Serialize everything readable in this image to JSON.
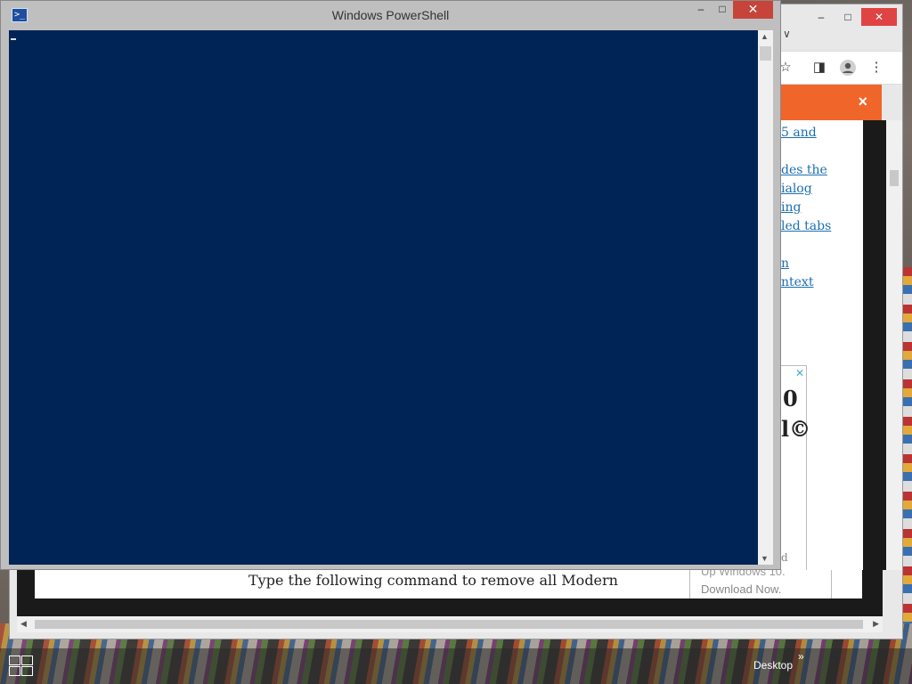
{
  "powershell": {
    "title": "Windows PowerShell",
    "icon": "powershell-icon",
    "minimize": "–",
    "maximize": "□",
    "close": "✕"
  },
  "browser": {
    "minimize": "–",
    "maximize": "□",
    "close": "✕",
    "tab_arrow": "∨",
    "toolbar_icons": [
      "star-icon",
      "sidebar-icon",
      "profile-icon",
      "more-icon"
    ],
    "star": "☆",
    "sidebar": "◨",
    "more": "⋮",
    "banner_close": "×",
    "banner_color": "#f0652a",
    "links": [
      "5 and",
      "des the",
      "ialog",
      "ing",
      "led tabs",
      "n",
      "ntext"
    ],
    "ad": {
      "close_glyph": "✕",
      "big1": "0",
      "big2": "l©",
      "small1": "d",
      "line1": "Up Windows 10.",
      "line2": "Download Now."
    },
    "article_text": "Type the following command to remove all Modern"
  },
  "taskbar": {
    "desktop_label": "Desktop",
    "chevron": "»"
  },
  "colors": {
    "console_bg": "#012456",
    "close_red": "#c7443a"
  }
}
